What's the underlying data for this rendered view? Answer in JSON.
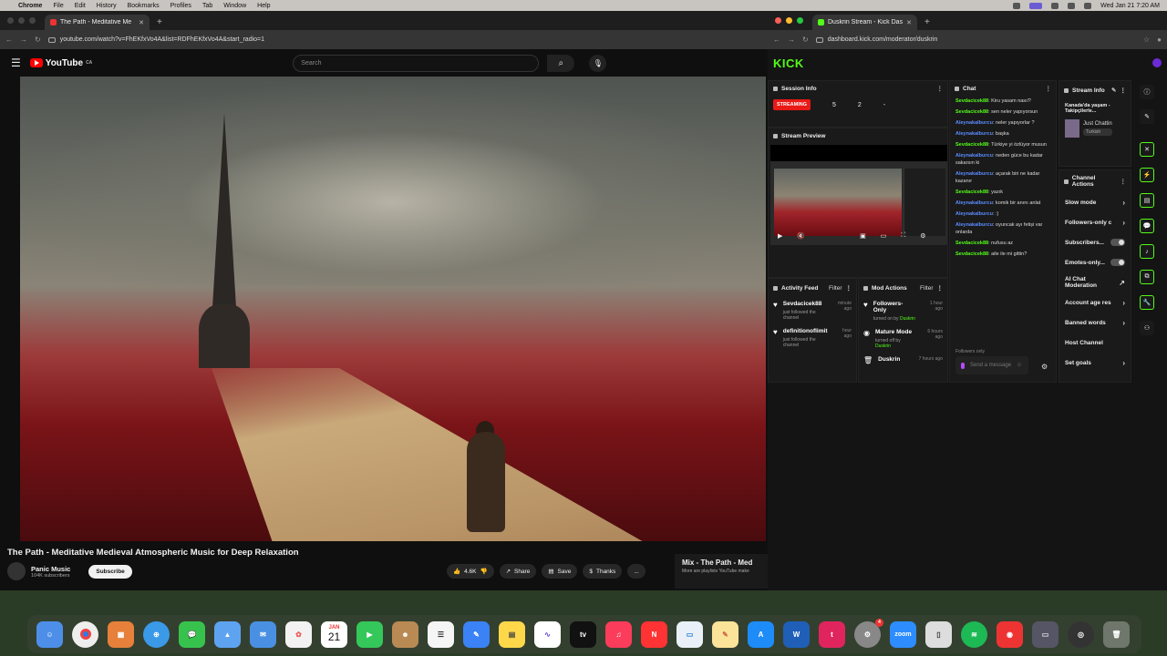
{
  "menubar": {
    "app": "Chrome",
    "items": [
      "File",
      "Edit",
      "History",
      "Bookmarks",
      "Profiles",
      "Tab",
      "Window",
      "Help"
    ],
    "clock": "Wed Jan 21  7:20 AM"
  },
  "left_browser": {
    "tab_title": "The Path - Meditative Me",
    "url": "youtube.com/watch?v=FhEKfxVo4A&list=RDFhEKfxVo4A&start_radio=1"
  },
  "youtube": {
    "logo_text": "YouTube",
    "country": "CA",
    "search_placeholder": "Search",
    "video_title": "The Path - Meditative Medieval Atmospheric Music for Deep Relaxation",
    "channel_name": "Panic Music",
    "subscribers": "104K subscribers",
    "subscribe_label": "Subscribe",
    "likes": "4.6K",
    "share_label": "Share",
    "save_label": "Save",
    "thanks_label": "Thanks",
    "more_label": "...",
    "mix_title": "Mix - The Path - Med",
    "mix_sub": "More are playlists YouTube make"
  },
  "right_browser": {
    "tab_title": "Duskrin Stream - Kick Dashb",
    "url": "dashboard.kick.com/moderator/duskrin"
  },
  "kick": {
    "logo": "KICK",
    "session_info": {
      "title": "Session Info",
      "status": "STREAMING",
      "stat1": "5",
      "stat2": "2",
      "stat3": "-"
    },
    "stream_preview": {
      "title": "Stream Preview"
    },
    "activity_feed": {
      "title": "Activity Feed",
      "filter": "Filter",
      "items": [
        {
          "user": "Sevdacicek88",
          "note": "just followed the channel",
          "time": "minute ago"
        },
        {
          "user": "definitionoflimit",
          "note": "just followed the channel",
          "time": "hour ago"
        }
      ]
    },
    "mod_actions": {
      "title": "Mod Actions",
      "filter": "Filter",
      "items": [
        {
          "action": "Followers-Only",
          "detail": "turned on by",
          "by": "Duskrin",
          "time": "1 hour ago"
        },
        {
          "action": "Mature Mode",
          "detail": "turned off by",
          "by": "Duskrin",
          "time": "6 hours ago"
        },
        {
          "action": "Duskrin",
          "detail": "",
          "by": "",
          "time": "7 hours ago"
        }
      ]
    },
    "chat": {
      "title": "Chat",
      "messages": [
        {
          "user": "Sevdacicek88",
          "color": "#53fc18",
          "text": "Kiru yasam nasıl?"
        },
        {
          "user": "Sevdacicek88",
          "color": "#53fc18",
          "text": "sen neler yapıyorsun"
        },
        {
          "user": "Aleynakalburcu",
          "color": "#5b8cff",
          "text": "neler yapıyorlar ?"
        },
        {
          "user": "Aleynakalburcu",
          "color": "#5b8cff",
          "text": "başka"
        },
        {
          "user": "Sevdacicek88",
          "color": "#53fc18",
          "text": "Türkiye yi özlüyor musun"
        },
        {
          "user": "Aleynakalburcu",
          "color": "#5b8cff",
          "text": "neden güce bu kadar sakarsın ki"
        },
        {
          "user": "Aleynakalburcu",
          "color": "#5b8cff",
          "text": "açarak biri ne kadar kazanır"
        },
        {
          "user": "Sevdacicek88",
          "color": "#53fc18",
          "text": "yazık"
        },
        {
          "user": "Aleynakalburcu",
          "color": "#5b8cff",
          "text": "komik bir anını anlat"
        },
        {
          "user": "Aleynakalburcu",
          "color": "#5b8cff",
          "text": ":)"
        },
        {
          "user": "Aleynakalburcu",
          "color": "#5b8cff",
          "text": "oyuncak ayı fetiși var onlarda"
        },
        {
          "user": "Sevdacicek88",
          "color": "#53fc18",
          "text": "nufusu az"
        },
        {
          "user": "Sevdacicek88",
          "color": "#53fc18",
          "text": "aile ile mi gittin?"
        }
      ],
      "followers_only": "Followers only",
      "input_placeholder": "Send a message"
    },
    "stream_info": {
      "title": "Stream Info",
      "stream_title": "Kanada'da yaşam - Takipçilerle...",
      "category": "Just Chattin",
      "tag": "Turkish"
    },
    "channel_actions": {
      "title": "Channel Actions",
      "rows": [
        {
          "label": "Slow mode"
        },
        {
          "label": "Followers-only c",
          "sub": "1 min"
        },
        {
          "label": "Subscribers..."
        },
        {
          "label": "Emotes-only..."
        },
        {
          "label": "AI Chat Moderation"
        },
        {
          "label": "Account age res"
        },
        {
          "label": "Banned words"
        },
        {
          "label": "Host Channel"
        },
        {
          "label": "Set goals"
        }
      ]
    }
  },
  "dock": {
    "calendar_month": "JAN",
    "calendar_day": "21",
    "zoom_label": "zoom",
    "tv_label": "tv",
    "badge": "4"
  }
}
